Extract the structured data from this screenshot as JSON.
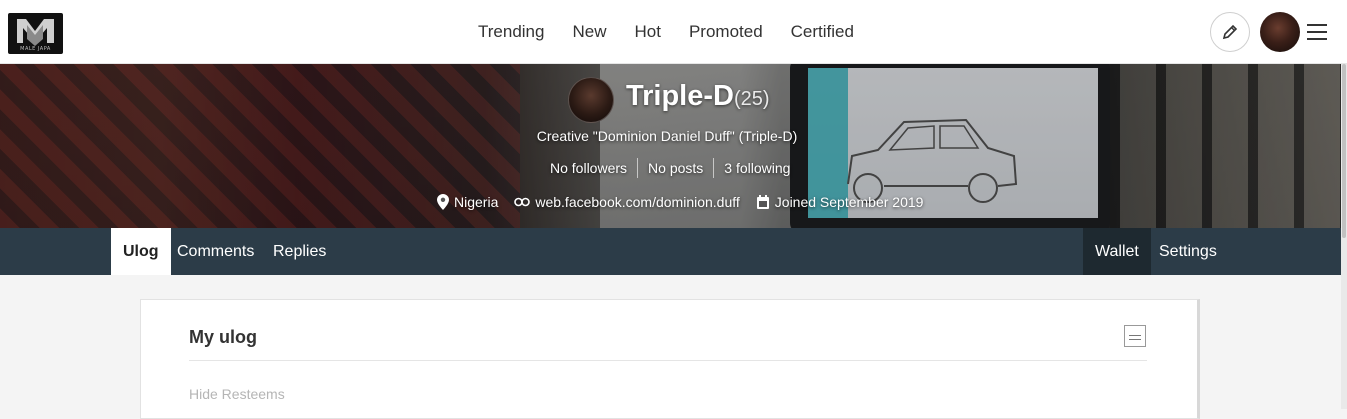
{
  "header": {
    "logo_text": "MALE JAPA",
    "nav": [
      "Trending",
      "New",
      "Hot",
      "Promoted",
      "Certified"
    ],
    "icons": {
      "edit": "pencil-icon",
      "menu": "hamburger-menu-icon"
    }
  },
  "profile": {
    "name": "Triple-D",
    "reputation": "(25)",
    "about": "Creative \"Dominion Daniel Duff\" (Triple-D)",
    "stats": {
      "followers": "No followers",
      "posts": "No posts",
      "following": "3 following"
    },
    "location": "Nigeria",
    "website": "web.facebook.com/dominion.duff",
    "joined": "Joined September 2019"
  },
  "subnav": {
    "tabs": [
      "Ulog",
      "Comments",
      "Replies"
    ],
    "active_tab": "Ulog",
    "right_tabs": [
      "Wallet",
      "Settings"
    ]
  },
  "feed": {
    "title": "My ulog",
    "hide_resteems": "Hide Resteems"
  },
  "colors": {
    "subnav_bg": "#2c3c48",
    "header_bg": "#ffffff"
  }
}
